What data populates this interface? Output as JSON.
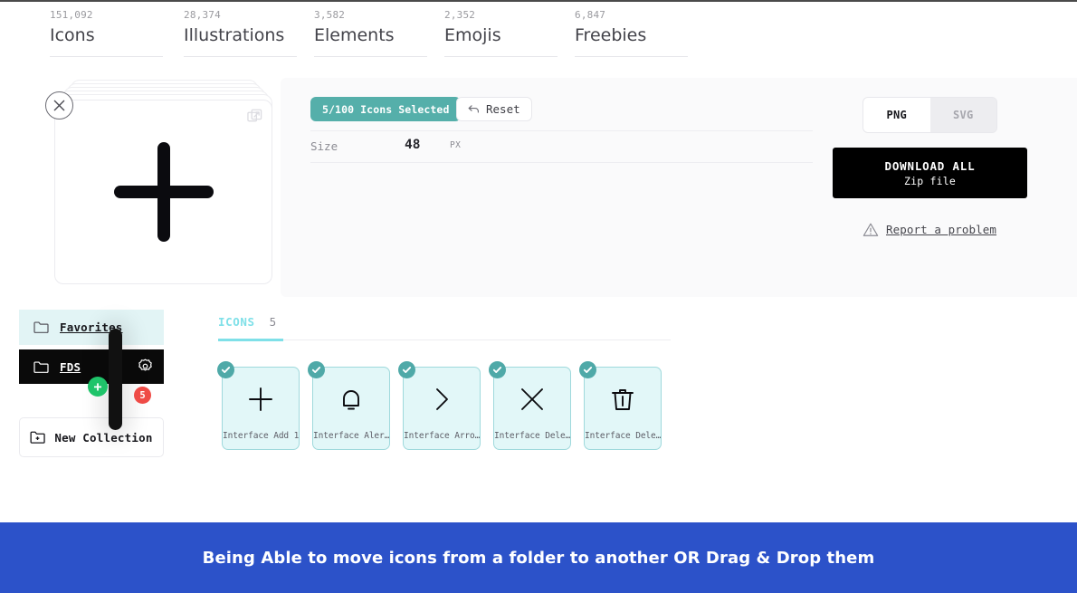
{
  "stats": [
    {
      "count": "151,092",
      "label": "Icons"
    },
    {
      "count": "28,374",
      "label": "Illustrations"
    },
    {
      "count": "3,582",
      "label": "Elements"
    },
    {
      "count": "2,352",
      "label": "Emojis"
    },
    {
      "count": "6,847",
      "label": "Freebies"
    }
  ],
  "toolbar": {
    "selection_badge": "5/100 Icons Selected",
    "reset_label": "Reset",
    "size_label": "Size",
    "size_value": "48",
    "size_unit": "PX"
  },
  "format": {
    "options": [
      "PNG",
      "SVG"
    ],
    "selected": "PNG"
  },
  "download": {
    "title": "DOWNLOAD ALL",
    "subtitle": "Zip file"
  },
  "report": {
    "label": "Report a problem"
  },
  "preview": {
    "icon_name": "plus-icon",
    "expand_icon": "open-in-new-icon",
    "close_icon": "close-icon"
  },
  "sidebar": {
    "collections": [
      {
        "name": "Favorites",
        "active": true,
        "icon": "folder-icon"
      },
      {
        "name": "FDS",
        "active": false,
        "icon": "folder-icon",
        "settings_icon": "gear-icon"
      }
    ],
    "drag_add_badge": "+",
    "drag_count_badge": "5",
    "new_collection_label": "New Collection",
    "new_collection_icon": "folder-plus-icon"
  },
  "content": {
    "tab_label": "ICONS",
    "tab_count": "5",
    "icons": [
      {
        "caption": "Interface Add 1",
        "icon": "plus-icon",
        "selected": true
      },
      {
        "caption": "Interface Aler…",
        "icon": "bell-icon",
        "selected": true
      },
      {
        "caption": "Interface Arro…",
        "icon": "chevron-right-icon",
        "selected": true
      },
      {
        "caption": "Interface Dele…",
        "icon": "close-x-icon",
        "selected": true
      },
      {
        "caption": "Interface Dele…",
        "icon": "trash-icon",
        "selected": true
      }
    ]
  },
  "banner": {
    "text": "Being Able to move icons from a folder to another OR Drag & Drop them"
  },
  "colors": {
    "teal": "#55afaa",
    "cyan": "#7fe0e8",
    "card_bg": "#e2f7f8",
    "banner_blue": "#2c52c9",
    "green_badge": "#1fc46a",
    "red_badge": "#ef4b46"
  }
}
